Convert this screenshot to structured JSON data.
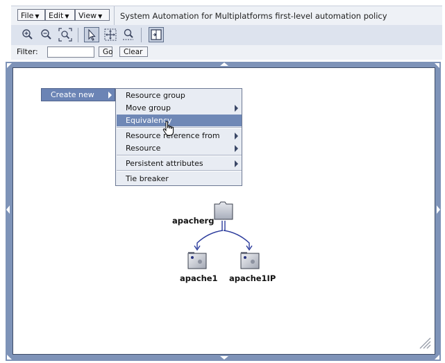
{
  "menubar": {
    "file": "File",
    "edit": "Edit",
    "view": "View",
    "dropdown_glyph": "▼",
    "title": "System Automation for Multiplatforms first-level automation policy"
  },
  "toolbar": {
    "tools": [
      "zoom-in-icon",
      "zoom-out-icon",
      "zoom-fit-icon",
      "select-pointer-icon",
      "pan-move-icon",
      "zoom-select-icon",
      "fit-window-icon"
    ]
  },
  "filter": {
    "label": "Filter:",
    "value": "",
    "go": "Go",
    "clear": "Clear"
  },
  "context_menu": {
    "trigger": "Create new",
    "items": [
      {
        "label": "Resource group",
        "submenu": false
      },
      {
        "label": "Move group",
        "submenu": true
      },
      {
        "label": "Equivalency",
        "submenu": false,
        "highlighted": true
      },
      {
        "label": "Resource reference from",
        "submenu": true
      },
      {
        "label": "Resource",
        "submenu": true
      },
      {
        "label": "Persistent attributes",
        "submenu": true
      },
      {
        "label": "Tie breaker",
        "submenu": false
      }
    ]
  },
  "graph": {
    "group": {
      "label": "apacherg",
      "icon": "folder-icon"
    },
    "members": [
      {
        "label": "apache1",
        "icon": "resource-icon"
      },
      {
        "label": "apache1IP",
        "icon": "resource-icon"
      }
    ]
  },
  "colors": {
    "accent": "#6f88b6",
    "frame": "#7e93b8",
    "edge": "#2b3b9c"
  }
}
